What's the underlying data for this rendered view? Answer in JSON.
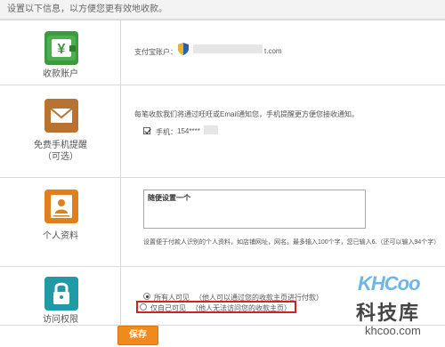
{
  "header": {
    "intro": "设置以下信息，以方便您更有效地收款。"
  },
  "rows": {
    "account": {
      "label": "收款账户",
      "field_label": "支付宝账户：",
      "account_suffix": "t.com"
    },
    "notify": {
      "label": "免费手机提醒",
      "sublabel": "（可选）",
      "desc": "每笔收款我们将通过旺旺或Email通知您，手机提醒更方便您接收通知。",
      "phone_label": "手机：",
      "phone_value": "154****"
    },
    "profile": {
      "label": "个人资料",
      "textarea_value": "随便设置一个",
      "hint": "设置便于付款人识别的个人资料，如店铺网址，网名。最多输入100个字，您已输入6.（还可以输入94个字）"
    },
    "access": {
      "label": "访问权限",
      "options": [
        {
          "label": "所有人可见",
          "note": "（他人可以通过您的收款主页进行付款）",
          "selected": true
        },
        {
          "label": "仅自己可见",
          "note": "（他人无法访问您的收款主页）",
          "selected": false
        }
      ]
    }
  },
  "actions": {
    "save_label": "保存"
  },
  "watermark": {
    "logo": "KHCoo",
    "name": "科技库",
    "url": "khcoo.com"
  },
  "colors": {
    "accent_orange": "#f08a1c",
    "icon_orange": "#f0a02a",
    "highlight_red": "#d22222",
    "watermark_blue": "#6fb6e8"
  },
  "icons": [
    "wallet-yen-icon",
    "envelope-icon",
    "id-card-icon",
    "padlock-icon",
    "shield-badge-icon"
  ]
}
